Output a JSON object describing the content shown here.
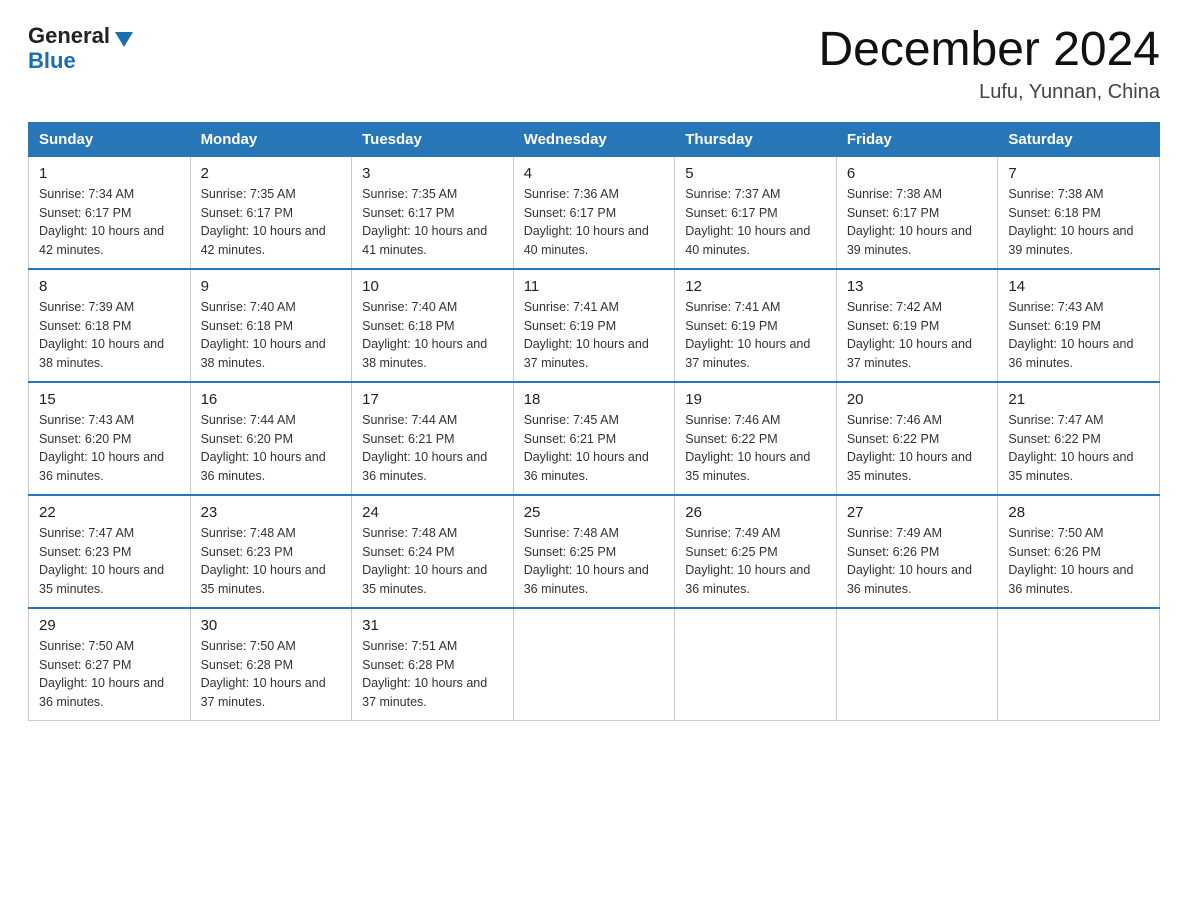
{
  "header": {
    "logo_general": "General",
    "logo_blue": "Blue",
    "month_title": "December 2024",
    "location": "Lufu, Yunnan, China"
  },
  "weekdays": [
    "Sunday",
    "Monday",
    "Tuesday",
    "Wednesday",
    "Thursday",
    "Friday",
    "Saturday"
  ],
  "weeks": [
    [
      {
        "day": "1",
        "sunrise": "7:34 AM",
        "sunset": "6:17 PM",
        "daylight": "10 hours and 42 minutes."
      },
      {
        "day": "2",
        "sunrise": "7:35 AM",
        "sunset": "6:17 PM",
        "daylight": "10 hours and 42 minutes."
      },
      {
        "day": "3",
        "sunrise": "7:35 AM",
        "sunset": "6:17 PM",
        "daylight": "10 hours and 41 minutes."
      },
      {
        "day": "4",
        "sunrise": "7:36 AM",
        "sunset": "6:17 PM",
        "daylight": "10 hours and 40 minutes."
      },
      {
        "day": "5",
        "sunrise": "7:37 AM",
        "sunset": "6:17 PM",
        "daylight": "10 hours and 40 minutes."
      },
      {
        "day": "6",
        "sunrise": "7:38 AM",
        "sunset": "6:17 PM",
        "daylight": "10 hours and 39 minutes."
      },
      {
        "day": "7",
        "sunrise": "7:38 AM",
        "sunset": "6:18 PM",
        "daylight": "10 hours and 39 minutes."
      }
    ],
    [
      {
        "day": "8",
        "sunrise": "7:39 AM",
        "sunset": "6:18 PM",
        "daylight": "10 hours and 38 minutes."
      },
      {
        "day": "9",
        "sunrise": "7:40 AM",
        "sunset": "6:18 PM",
        "daylight": "10 hours and 38 minutes."
      },
      {
        "day": "10",
        "sunrise": "7:40 AM",
        "sunset": "6:18 PM",
        "daylight": "10 hours and 38 minutes."
      },
      {
        "day": "11",
        "sunrise": "7:41 AM",
        "sunset": "6:19 PM",
        "daylight": "10 hours and 37 minutes."
      },
      {
        "day": "12",
        "sunrise": "7:41 AM",
        "sunset": "6:19 PM",
        "daylight": "10 hours and 37 minutes."
      },
      {
        "day": "13",
        "sunrise": "7:42 AM",
        "sunset": "6:19 PM",
        "daylight": "10 hours and 37 minutes."
      },
      {
        "day": "14",
        "sunrise": "7:43 AM",
        "sunset": "6:19 PM",
        "daylight": "10 hours and 36 minutes."
      }
    ],
    [
      {
        "day": "15",
        "sunrise": "7:43 AM",
        "sunset": "6:20 PM",
        "daylight": "10 hours and 36 minutes."
      },
      {
        "day": "16",
        "sunrise": "7:44 AM",
        "sunset": "6:20 PM",
        "daylight": "10 hours and 36 minutes."
      },
      {
        "day": "17",
        "sunrise": "7:44 AM",
        "sunset": "6:21 PM",
        "daylight": "10 hours and 36 minutes."
      },
      {
        "day": "18",
        "sunrise": "7:45 AM",
        "sunset": "6:21 PM",
        "daylight": "10 hours and 36 minutes."
      },
      {
        "day": "19",
        "sunrise": "7:46 AM",
        "sunset": "6:22 PM",
        "daylight": "10 hours and 35 minutes."
      },
      {
        "day": "20",
        "sunrise": "7:46 AM",
        "sunset": "6:22 PM",
        "daylight": "10 hours and 35 minutes."
      },
      {
        "day": "21",
        "sunrise": "7:47 AM",
        "sunset": "6:22 PM",
        "daylight": "10 hours and 35 minutes."
      }
    ],
    [
      {
        "day": "22",
        "sunrise": "7:47 AM",
        "sunset": "6:23 PM",
        "daylight": "10 hours and 35 minutes."
      },
      {
        "day": "23",
        "sunrise": "7:48 AM",
        "sunset": "6:23 PM",
        "daylight": "10 hours and 35 minutes."
      },
      {
        "day": "24",
        "sunrise": "7:48 AM",
        "sunset": "6:24 PM",
        "daylight": "10 hours and 35 minutes."
      },
      {
        "day": "25",
        "sunrise": "7:48 AM",
        "sunset": "6:25 PM",
        "daylight": "10 hours and 36 minutes."
      },
      {
        "day": "26",
        "sunrise": "7:49 AM",
        "sunset": "6:25 PM",
        "daylight": "10 hours and 36 minutes."
      },
      {
        "day": "27",
        "sunrise": "7:49 AM",
        "sunset": "6:26 PM",
        "daylight": "10 hours and 36 minutes."
      },
      {
        "day": "28",
        "sunrise": "7:50 AM",
        "sunset": "6:26 PM",
        "daylight": "10 hours and 36 minutes."
      }
    ],
    [
      {
        "day": "29",
        "sunrise": "7:50 AM",
        "sunset": "6:27 PM",
        "daylight": "10 hours and 36 minutes."
      },
      {
        "day": "30",
        "sunrise": "7:50 AM",
        "sunset": "6:28 PM",
        "daylight": "10 hours and 37 minutes."
      },
      {
        "day": "31",
        "sunrise": "7:51 AM",
        "sunset": "6:28 PM",
        "daylight": "10 hours and 37 minutes."
      },
      null,
      null,
      null,
      null
    ]
  ]
}
